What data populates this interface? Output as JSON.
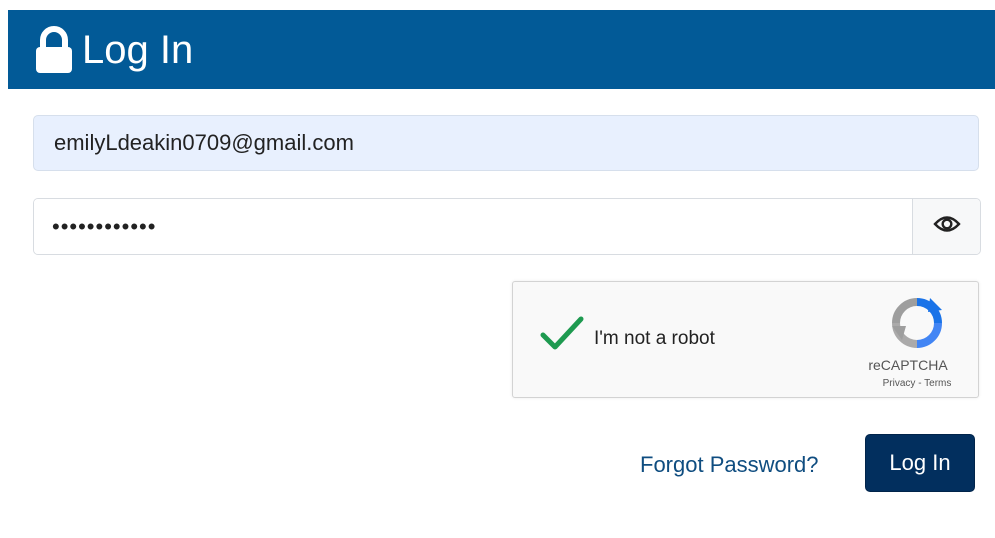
{
  "header": {
    "title": "Log In",
    "icon": "lock-icon",
    "background": "#025a97"
  },
  "form": {
    "email_value": "emilyLdeakin0709@gmail.com",
    "password_value": "••••••••••••",
    "show_password_icon": "eye-icon"
  },
  "recaptcha": {
    "label": "I'm not a robot",
    "checked": true,
    "brand": "reCAPTCHA",
    "privacy_label": "Privacy",
    "separator": " - ",
    "terms_label": "Terms",
    "check_color": "#1e9a50"
  },
  "actions": {
    "forgot_label": "Forgot Password?",
    "login_label": "Log In",
    "login_color": "#022f5e"
  }
}
